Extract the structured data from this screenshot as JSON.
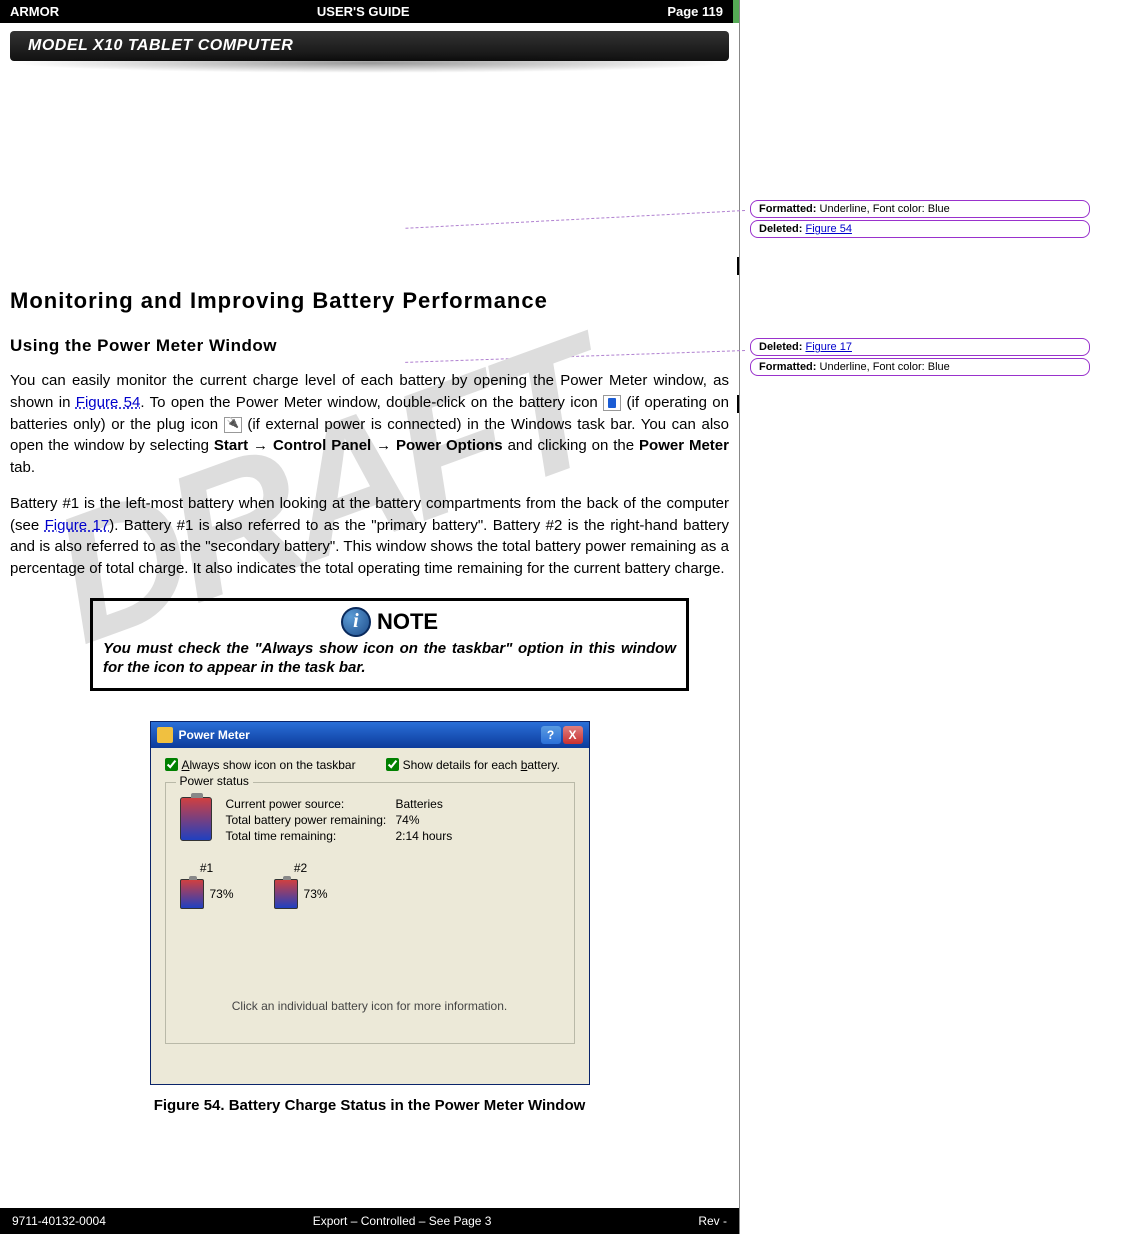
{
  "header": {
    "left": "ARMOR",
    "center": "USER'S GUIDE",
    "right": "Page 119"
  },
  "model_bar": "MODEL X10 TABLET COMPUTER",
  "watermark": "DRAFT",
  "h1": "Monitoring and Improving Battery Performance",
  "h2": "Using the Power Meter Window",
  "para1_a": "You can easily monitor the current charge level of each battery by opening the Power Meter window, as shown in ",
  "para1_link": "Figure 54",
  "para1_b": ". To open the Power Meter window, double-click on the battery icon ",
  "para1_c": " (if operating on batteries only) or the plug icon ",
  "para1_d": " (if external power is connected) in the Windows task bar.  You can also open the window by selecting ",
  "para1_bold1": "Start → Control Panel → Power Options",
  "para1_e": " and clicking on the ",
  "para1_bold2": "Power Meter",
  "para1_f": " tab.",
  "para2_a": "Battery #1 is the left-most battery when looking at the battery compartments from the back of the computer (see ",
  "para2_link": "Figure 17",
  "para2_b": "). Battery #1 is also referred to as the \"primary battery\". Battery #2 is the right-hand battery and is also referred to as the \"secondary battery\". This window shows the total battery power remaining as a percentage of total charge. It also indicates the total operating time remaining for the current battery charge.",
  "note": {
    "title": "NOTE",
    "body": "You must check the \"Always show icon on the taskbar\" option in this window for the icon to appear in the task bar."
  },
  "screenshot": {
    "title": "Power Meter",
    "help": "?",
    "close": "X",
    "check1": "Always show icon on the taskbar",
    "check1_u": "A",
    "check2": "Show details for each battery.",
    "check2_u": "b",
    "group_title": "Power status",
    "status": {
      "l1": "Current power source:",
      "v1": "Batteries",
      "l2": "Total battery power remaining:",
      "v2": "74%",
      "l3": "Total time remaining:",
      "v3": "2:14 hours"
    },
    "batteries": {
      "b1_label": "#1",
      "b1_pct": "73%",
      "b2_label": "#2",
      "b2_pct": "73%"
    },
    "hint": "Click an individual battery icon for more information."
  },
  "figure_caption": "Figure 54.  Battery Charge Status in the Power Meter Window",
  "footer": {
    "left": "9711-40132-0004",
    "center": "Export – Controlled – See Page 3",
    "right": "Rev -"
  },
  "revisions": {
    "r1a_label": "Formatted:",
    "r1a_text": " Underline, Font color: Blue",
    "r1b_label": "Deleted:",
    "r1b_link": "Figure 54",
    "r2a_label": "Deleted:",
    "r2a_link": "Figure 17",
    "r2b_label": "Formatted:",
    "r2b_text": " Underline, Font color: Blue"
  }
}
